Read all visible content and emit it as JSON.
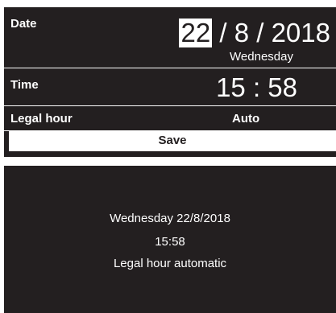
{
  "settings": {
    "date": {
      "label": "Date",
      "day": "22",
      "separator1": " / ",
      "month": "8",
      "separator2": " / ",
      "year": "2018",
      "weekday": "Wednesday"
    },
    "time": {
      "label": "Time",
      "value": "15 : 58"
    },
    "legal_hour": {
      "label": "Legal hour",
      "value": "Auto"
    },
    "save_label": "Save"
  },
  "summary": {
    "date_line": "Wednesday 22/8/2018",
    "time_line": "15:58",
    "legal_line": "Legal hour automatic"
  }
}
